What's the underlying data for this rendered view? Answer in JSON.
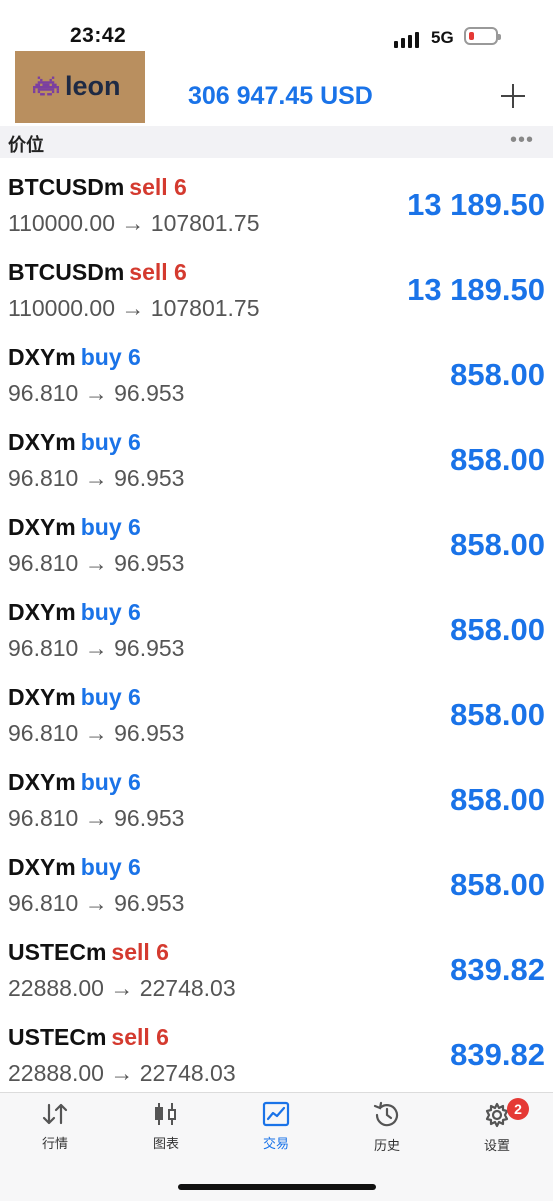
{
  "status": {
    "time": "23:42",
    "network": "5G"
  },
  "header": {
    "logo_text": "leon",
    "balance": "306 947.45 USD"
  },
  "section": {
    "title": "价位",
    "more": "•••"
  },
  "positions": [
    {
      "symbol": "BTCUSDm",
      "side": "sell",
      "side_label": "sell 6",
      "prices": "110000.00 → 107801.75",
      "profit": "13 189.50"
    },
    {
      "symbol": "BTCUSDm",
      "side": "sell",
      "side_label": "sell 6",
      "prices": "110000.00 → 107801.75",
      "profit": "13 189.50"
    },
    {
      "symbol": "DXYm",
      "side": "buy",
      "side_label": "buy 6",
      "prices": "96.810 → 96.953",
      "profit": "858.00"
    },
    {
      "symbol": "DXYm",
      "side": "buy",
      "side_label": "buy 6",
      "prices": "96.810 → 96.953",
      "profit": "858.00"
    },
    {
      "symbol": "DXYm",
      "side": "buy",
      "side_label": "buy 6",
      "prices": "96.810 → 96.953",
      "profit": "858.00"
    },
    {
      "symbol": "DXYm",
      "side": "buy",
      "side_label": "buy 6",
      "prices": "96.810 → 96.953",
      "profit": "858.00"
    },
    {
      "symbol": "DXYm",
      "side": "buy",
      "side_label": "buy 6",
      "prices": "96.810 → 96.953",
      "profit": "858.00"
    },
    {
      "symbol": "DXYm",
      "side": "buy",
      "side_label": "buy 6",
      "prices": "96.810 → 96.953",
      "profit": "858.00"
    },
    {
      "symbol": "DXYm",
      "side": "buy",
      "side_label": "buy 6",
      "prices": "96.810 → 96.953",
      "profit": "858.00"
    },
    {
      "symbol": "USTECm",
      "side": "sell",
      "side_label": "sell 6",
      "prices": "22888.00 → 22748.03",
      "profit": "839.82"
    },
    {
      "symbol": "USTECm",
      "side": "sell",
      "side_label": "sell 6",
      "prices": "22888.00 → 22748.03",
      "profit": "839.82"
    }
  ],
  "tabbar": {
    "tabs": [
      {
        "label": "行情",
        "icon": "quotes-arrows-icon"
      },
      {
        "label": "图表",
        "icon": "candlestick-chart-icon"
      },
      {
        "label": "交易",
        "icon": "trade-chart-icon",
        "active": true
      },
      {
        "label": "历史",
        "icon": "history-clock-icon"
      },
      {
        "label": "设置",
        "icon": "gear-icon",
        "badge": "2"
      }
    ]
  },
  "colors": {
    "accent": "#1a73e8",
    "sell": "#d43a2f",
    "logo_bg": "#b98f5f"
  }
}
